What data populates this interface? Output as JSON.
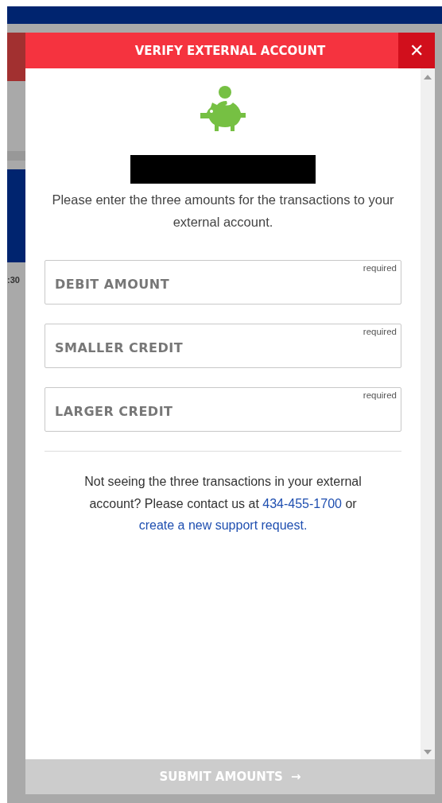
{
  "background": {
    "fragment": ":30"
  },
  "dialog": {
    "title": "VERIFY EXTERNAL ACCOUNT",
    "close": "✕",
    "instructions": "Please enter the three amounts for the transactions to your external account.",
    "fields": [
      {
        "placeholder": "DEBIT AMOUNT",
        "hint": "required"
      },
      {
        "placeholder": "SMALLER CREDIT",
        "hint": "required"
      },
      {
        "placeholder": "LARGER CREDIT",
        "hint": "required"
      }
    ],
    "help": {
      "before": "Not seeing the three transactions in your external account? Please contact us at ",
      "phone": "434-455-1700",
      "middle": " or ",
      "link": "create a new support request."
    },
    "submit": {
      "label": "SUBMIT AMOUNTS",
      "arrow": "→",
      "disabled": true
    }
  }
}
